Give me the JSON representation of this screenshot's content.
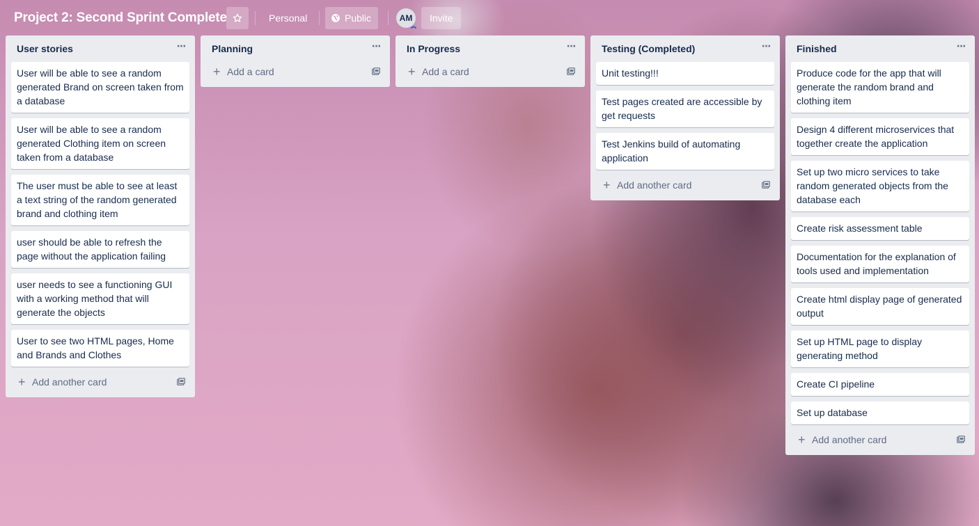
{
  "board": {
    "title": "Project 2: Second Sprint Complete",
    "personal_label": "Personal",
    "visibility_label": "Public",
    "avatar_initials": "AM",
    "invite_label": "Invite"
  },
  "lists": [
    {
      "title": "User stories",
      "cards": [
        "User will be able to see a random generated Brand on screen taken from a database",
        "User will be able to see a random generated Clothing item on screen taken from a database",
        "The user must be able to see at least a text string of the random generated brand and clothing item",
        "user should be able to refresh the page without the application failing",
        "user needs to see a functioning GUI with a working method that will generate the objects",
        "User to see two HTML pages, Home and Brands and Clothes"
      ],
      "add_label": "Add another card"
    },
    {
      "title": "Planning",
      "cards": [],
      "add_label": "Add a card"
    },
    {
      "title": "In Progress",
      "cards": [],
      "add_label": "Add a card"
    },
    {
      "title": "Testing (Completed)",
      "cards": [
        "Unit testing!!!",
        "Test pages created are accessible by get requests",
        "Test Jenkins build of automating application"
      ],
      "add_label": "Add another card"
    },
    {
      "title": "Finished",
      "cards": [
        "Produce code for the app that will generate the random brand and clothing item",
        "Design 4 different microservices that together create the application",
        "Set up two micro services to take random generated objects from the database each",
        "Create risk assessment table",
        "Documentation for the explanation of tools used and implementation",
        "Create html display page of generated output",
        "Set up HTML page to display generating method",
        "Create CI pipeline",
        "Set up database"
      ],
      "add_label": "Add another card"
    }
  ],
  "icons": {
    "star": "star-icon",
    "globe": "globe-icon",
    "menu": "more-icon",
    "plus": "plus-icon",
    "template": "card-template-icon"
  }
}
